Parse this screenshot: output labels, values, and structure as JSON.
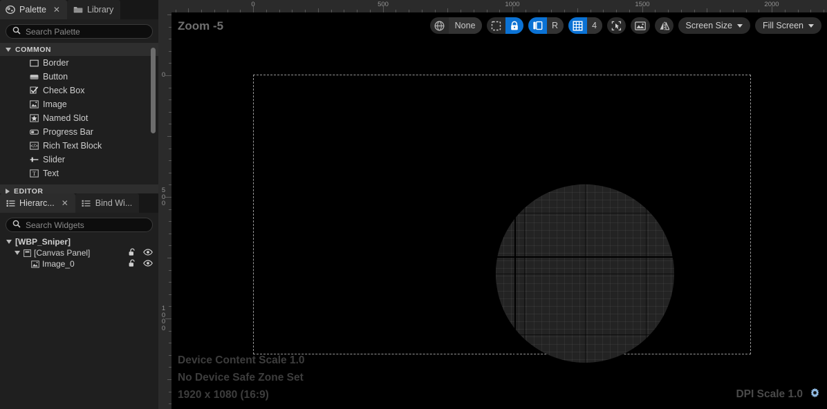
{
  "palette_panel": {
    "tabs": [
      {
        "label": "Palette",
        "icon": "palette-icon",
        "active": true,
        "closable": true
      },
      {
        "label": "Library",
        "icon": "folder-icon",
        "active": false,
        "closable": false
      }
    ],
    "search": {
      "placeholder": "Search Palette",
      "value": "",
      "icon": "search-icon"
    },
    "categories": [
      {
        "label": "COMMON",
        "expanded": true,
        "items": [
          {
            "label": "Border",
            "icon": "border-icon"
          },
          {
            "label": "Button",
            "icon": "button-icon"
          },
          {
            "label": "Check Box",
            "icon": "checkbox-icon"
          },
          {
            "label": "Image",
            "icon": "image-icon"
          },
          {
            "label": "Named Slot",
            "icon": "named-slot-icon"
          },
          {
            "label": "Progress Bar",
            "icon": "progress-bar-icon"
          },
          {
            "label": "Rich Text Block",
            "icon": "rich-text-icon"
          },
          {
            "label": "Slider",
            "icon": "slider-icon"
          },
          {
            "label": "Text",
            "icon": "text-icon"
          }
        ]
      },
      {
        "label": "EDITOR",
        "expanded": false,
        "items": []
      }
    ]
  },
  "hierarchy_panel": {
    "tabs": [
      {
        "label": "Hierarc...",
        "icon": "list-icon",
        "active": true,
        "closable": true
      },
      {
        "label": "Bind Wi...",
        "icon": "list-icon",
        "active": false,
        "closable": false
      }
    ],
    "search": {
      "placeholder": "Search Widgets",
      "value": "",
      "icon": "search-icon"
    },
    "tree": [
      {
        "label": "[WBP_Sniper]",
        "depth": 0,
        "expanded": true,
        "icon": "",
        "lock": false,
        "eye": false
      },
      {
        "label": "[Canvas Panel]",
        "depth": 1,
        "expanded": true,
        "icon": "canvas-panel-icon",
        "lock": true,
        "eye": true
      },
      {
        "label": "Image_0",
        "depth": 2,
        "expanded": null,
        "icon": "image-icon",
        "lock": true,
        "eye": true
      }
    ]
  },
  "rulers": {
    "top_labels": [
      "0",
      "500",
      "1000",
      "1500",
      "2000"
    ],
    "left_labels": [
      "0",
      "500",
      "1000"
    ]
  },
  "viewport": {
    "zoom_label": "Zoom -5",
    "toolbar": {
      "localization": {
        "icon": "globe-icon",
        "label": "None"
      },
      "dashed_select_icon": "dashed-rect-icon",
      "lock_icon": "lock-icon",
      "layout_icon": "layout-icon",
      "rotation_label": "R",
      "grid_icon": "grid-icon",
      "grid_size": "4",
      "snap_cursor_icon": "snap-cursor-icon",
      "image_icon": "image-snap-icon",
      "mirror_icon": "mirror-icon",
      "screen_size": "Screen Size",
      "fill_mode": "Fill Screen"
    },
    "status_left": [
      "Device Content Scale 1.0",
      "No Device Safe Zone Set",
      "1920 x 1080 (16:9)"
    ],
    "status_right": {
      "label": "DPI Scale 1.0",
      "icon": "gear-icon"
    },
    "cursor": "resize-diagonal-cursor"
  },
  "colors": {
    "accent": "#0b72d4",
    "panel_bg": "#1f1f1f",
    "viewport_bg": "#000000",
    "ruler_bg": "#2b2b2b",
    "text": "#cdcdcd"
  }
}
